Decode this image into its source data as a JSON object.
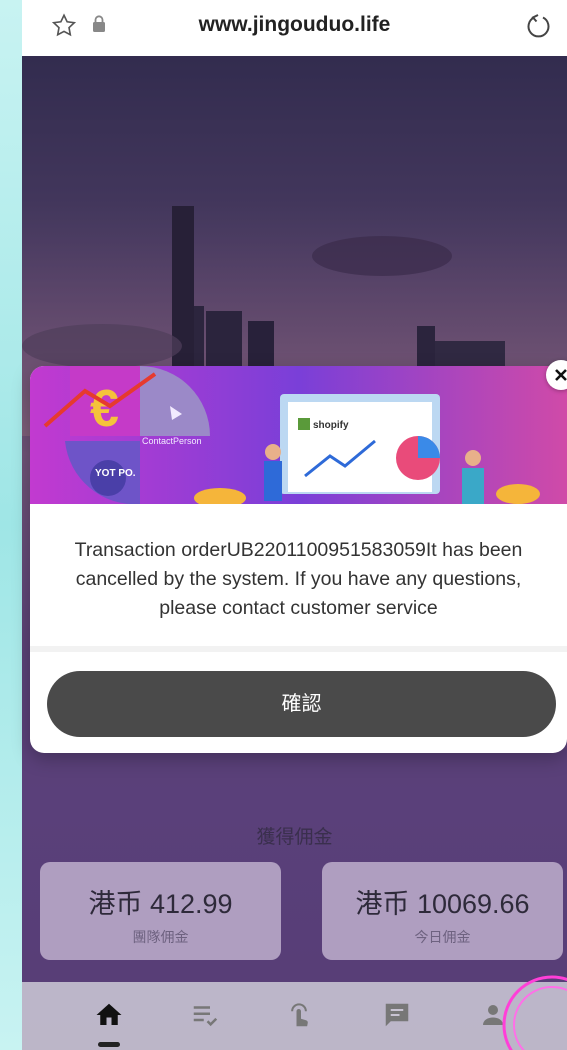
{
  "browser": {
    "url": "www.jingouduo.life",
    "icons": [
      "star-outline-icon",
      "lock-icon",
      "reload-icon"
    ]
  },
  "modal": {
    "banner_label": "shopify",
    "banner_brands": [
      "ContactPerson",
      "YOT PO."
    ],
    "message": "Transaction orderUB2201100951583059It has been cancelled by the system. If you have any questions, please contact customer service",
    "confirm_label": "確認"
  },
  "commission": {
    "title": "獲得佣金",
    "cards": [
      {
        "amount": "港币 412.99",
        "label": "團隊佣金"
      },
      {
        "amount": "港币 10069.66",
        "label": "今日佣金"
      }
    ]
  },
  "bottom_nav": {
    "items": [
      "home-icon",
      "task-list-icon",
      "tap-icon",
      "chat-icon",
      "user-icon"
    ],
    "active": "home-icon"
  },
  "colors": {
    "confirm_button": "#4a4a4a",
    "banner_accent": "#b03cc8",
    "background_purple": "#6a4d8c"
  }
}
